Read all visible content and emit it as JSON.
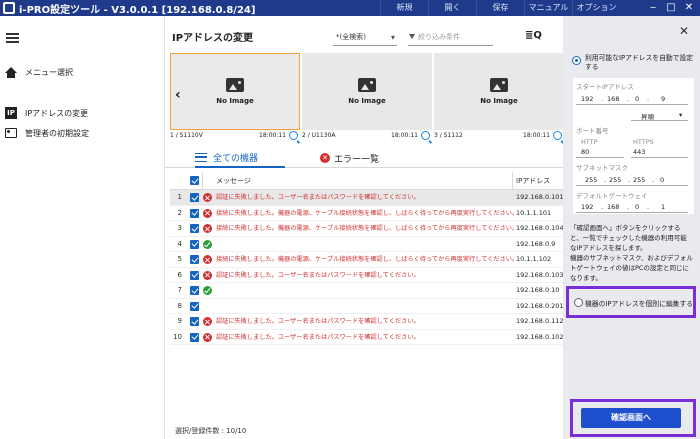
{
  "window": {
    "title": "i-PRO設定ツール - V3.0.0.1 [192.168.0.8/24]",
    "menu": [
      "新規",
      "開く",
      "保存",
      "マニュアル",
      "オプション"
    ],
    "buttons": [
      "‒",
      "□",
      "✕"
    ]
  },
  "sidebar": {
    "items": [
      {
        "label": "メニュー選択",
        "icon": "home-icon"
      },
      {
        "label": "IPアドレスの変更",
        "icon": "ip-icon"
      },
      {
        "label": "管理者の初期設定",
        "icon": "admin-icon"
      }
    ]
  },
  "main": {
    "title": "IPアドレスの変更",
    "filter_select": "*(全検索)",
    "filter_placeholder": "絞り込み条件",
    "view_label": "≣Q"
  },
  "cameras": [
    {
      "no_image": "No Image",
      "label": "1 / S1110V",
      "time": "18:00:11"
    },
    {
      "no_image": "No Image",
      "label": "2 / U1130A",
      "time": "18:00:11"
    },
    {
      "no_image": "No Image",
      "label": "3 / S1112",
      "time": "18:00:11"
    }
  ],
  "tabs": {
    "all": "全ての機器",
    "errors": "エラー一覧"
  },
  "table": {
    "headers": {
      "message": "メッセージ",
      "ip": "IPアドレス"
    },
    "rows": [
      {
        "no": "1",
        "status": "error",
        "message": "認証に失敗しました。ユーザー名またはパスワードを確認してください。",
        "ip": "192.168.0.101"
      },
      {
        "no": "2",
        "status": "error",
        "message": "接続に失敗しました。機器の電源、ケーブル接続状態を確認し、しばらく待ってから再度実行してください。",
        "ip": "10.1.1.101"
      },
      {
        "no": "3",
        "status": "error",
        "message": "接続に失敗しました。機器の電源、ケーブル接続状態を確認し、しばらく待ってから再度実行してください。",
        "ip": "192.168.0.104"
      },
      {
        "no": "4",
        "status": "ok",
        "message": "",
        "ip": "192.168.0.9"
      },
      {
        "no": "5",
        "status": "error",
        "message": "接続に失敗しました。機器の電源、ケーブル接続状態を確認し、しばらく待ってから再度実行してください。",
        "ip": "10.1.1.102"
      },
      {
        "no": "6",
        "status": "error",
        "message": "認証に失敗しました。ユーザー名またはパスワードを確認してください。",
        "ip": "192.168.0.103"
      },
      {
        "no": "7",
        "status": "ok",
        "message": "",
        "ip": "192.168.0.10"
      },
      {
        "no": "8",
        "status": "none",
        "message": "",
        "ip": "192.168.0.201"
      },
      {
        "no": "9",
        "status": "error",
        "message": "認証に失敗しました。ユーザー名またはパスワードを確認してください。",
        "ip": "192.168.0.112"
      },
      {
        "no": "10",
        "status": "error",
        "message": "認証に失敗しました。ユーザー名またはパスワードを確認してください。",
        "ip": "192.168.0.102"
      }
    ],
    "footer": "選択/登録件数 : 10/10"
  },
  "panel": {
    "option_auto": "利用可能なIPアドレスを自動で設定する",
    "start_ip_label": "スタートIPアドレス",
    "start_ip": [
      "192",
      "168",
      "0",
      "9"
    ],
    "sort_select": "昇順",
    "port_label": "ポート番号",
    "http_label": "HTTP",
    "http_value": "80",
    "https_label": "HTTPS",
    "https_value": "443",
    "subnet_label": "サブネットマスク",
    "subnet": [
      "255",
      "255",
      "255",
      "0"
    ],
    "gateway_label": "デフォルトゲートウェイ",
    "gateway": [
      "192",
      "168",
      "0",
      "1"
    ],
    "hint1": "「確認画面へ」ボタンをクリックすると、一覧でチェックした機器の利用可能なIPアドレスを探します。",
    "hint2": "機器のサブネットマスク、およびデフォルトゲートウェイの値はPCの設定と同じになります。",
    "option_individual": "機器のIPアドレスを個別に編集する",
    "confirm_button": "確認画面へ"
  },
  "colors": {
    "titlebar": "#1f3a8a",
    "accent": "#1565c0",
    "highlight_box": "#7a2fd6",
    "error": "#d32f2f",
    "ok": "#2e9e3a"
  }
}
